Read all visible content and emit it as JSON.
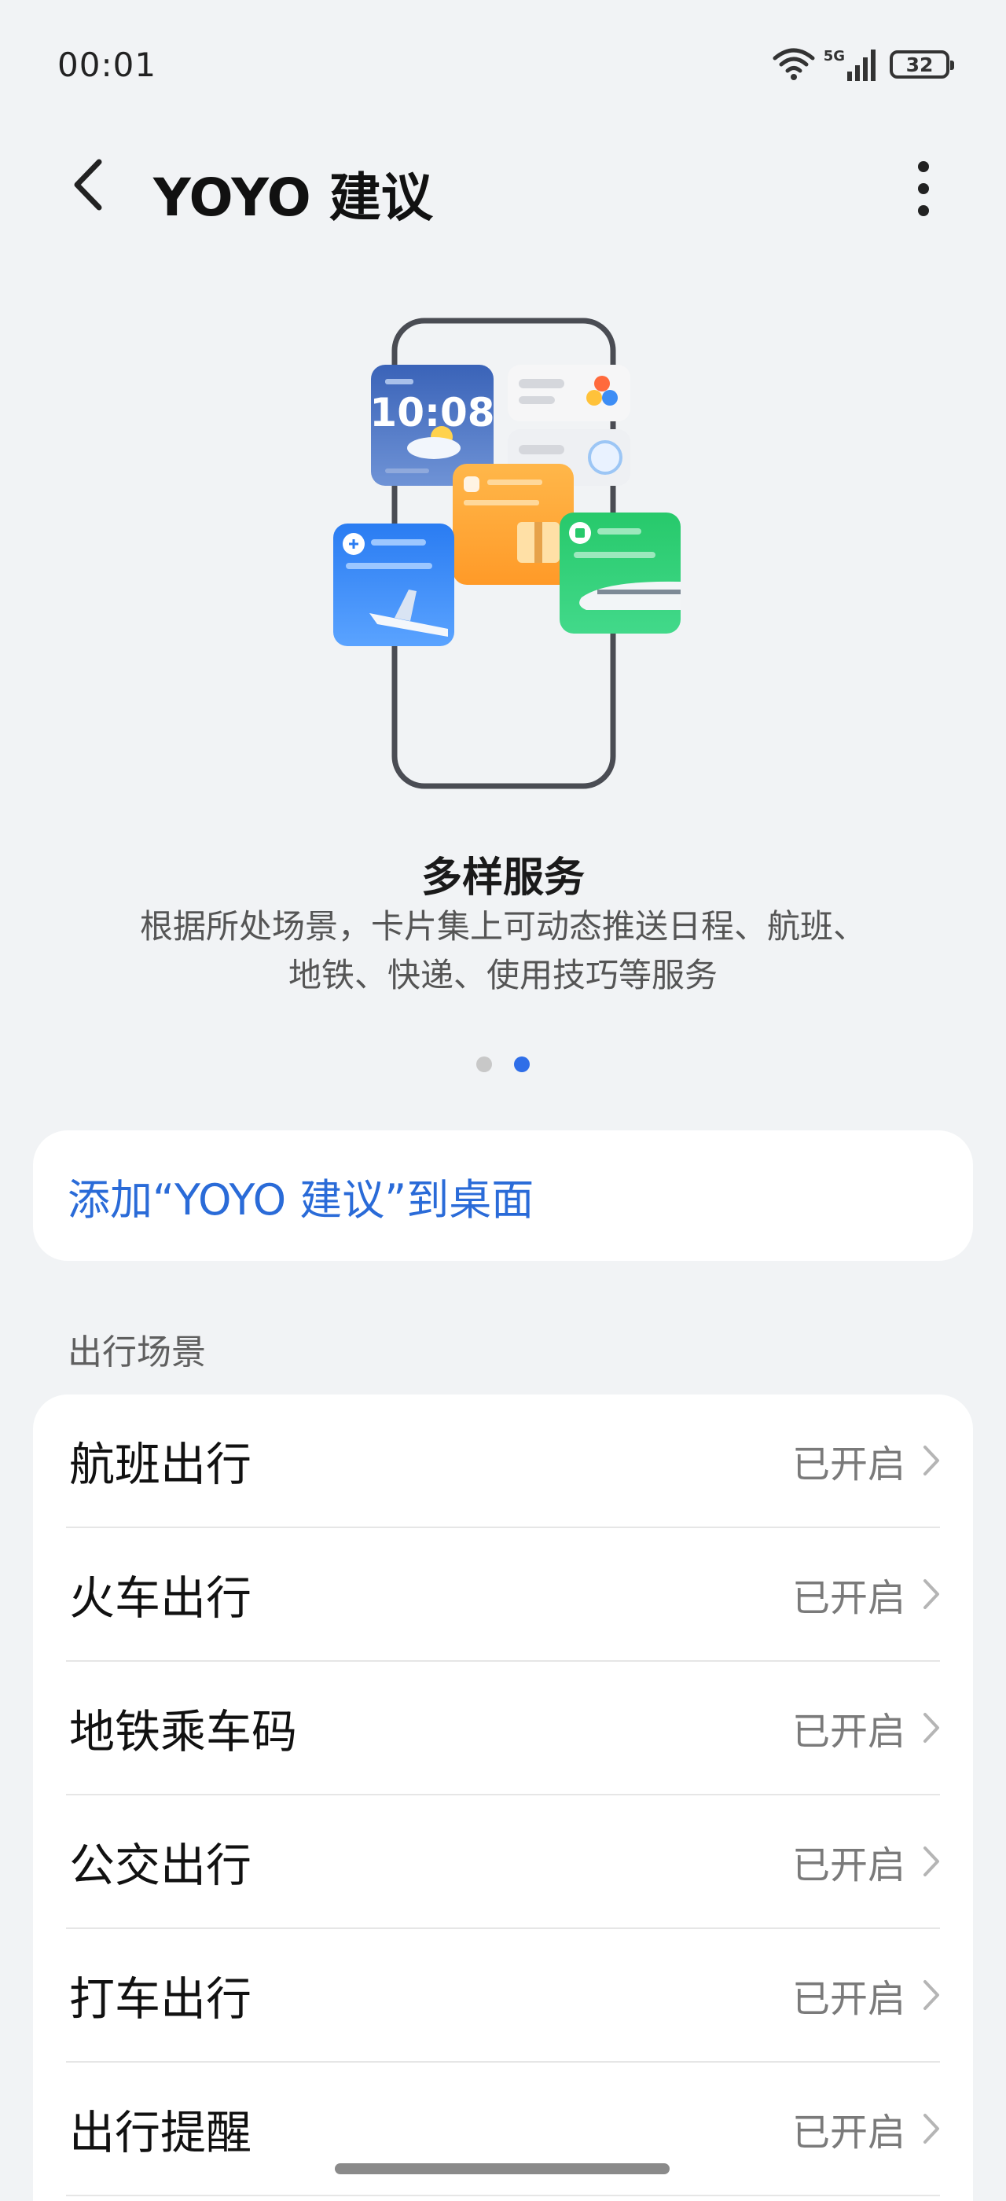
{
  "status_bar": {
    "time": "00:01",
    "network": "5G",
    "battery": "32"
  },
  "header": {
    "title": "YOYO 建议"
  },
  "carousel": {
    "title": "多样服务",
    "description_line1": "根据所处场景，卡片集上可动态推送日程、航班、",
    "description_line2": "地铁、快递、使用技巧等服务",
    "clock_widget_time": "10:08",
    "page_count": 2,
    "active_page": 2
  },
  "add_to_desktop": {
    "label": "添加“YOYO 建议”到桌面"
  },
  "travel_section": {
    "header": "出行场景",
    "items": [
      {
        "label": "航班出行",
        "status": "已开启"
      },
      {
        "label": "火车出行",
        "status": "已开启"
      },
      {
        "label": "地铁乘车码",
        "status": "已开启"
      },
      {
        "label": "公交出行",
        "status": "已开启"
      },
      {
        "label": "打车出行",
        "status": "已开启"
      },
      {
        "label": "出行提醒",
        "status": "已开启"
      }
    ]
  },
  "colors": {
    "accent": "#2a6bd8",
    "background": "#f1f3f5"
  }
}
